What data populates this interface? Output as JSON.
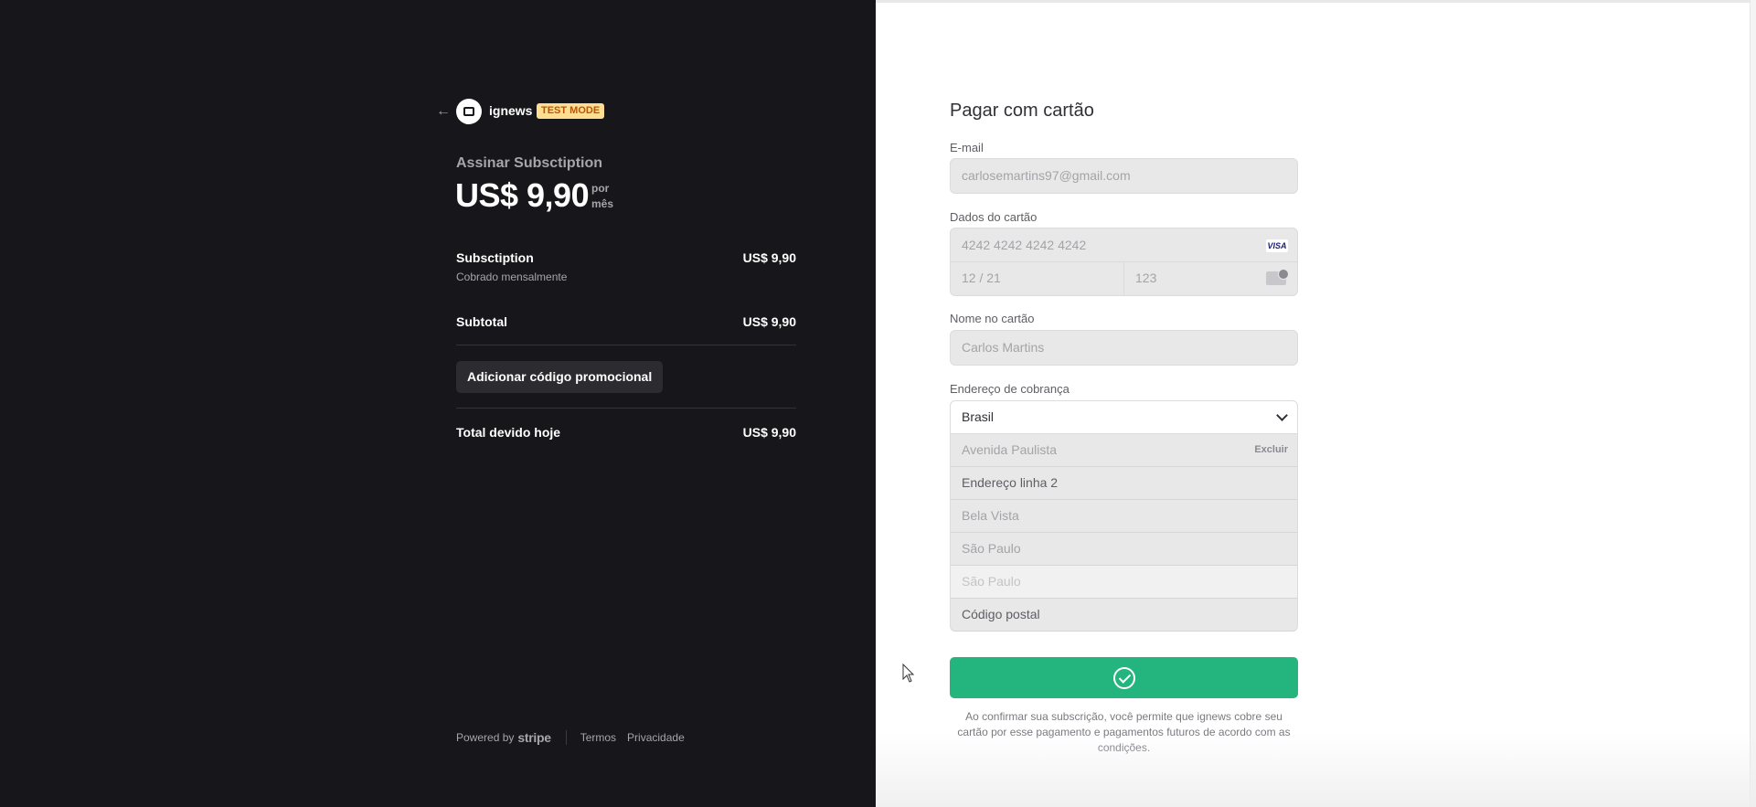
{
  "merchant": {
    "name": "ignews",
    "badge": "TEST MODE",
    "back_icon": "arrow-left-icon",
    "logo_icon": "store-logo-icon"
  },
  "summary": {
    "title": "Assinar Subsctiption",
    "price": "US$ 9,90",
    "per_line1": "por",
    "per_line2": "mês",
    "item_name": "Subsctiption",
    "item_price": "US$ 9,90",
    "item_note": "Cobrado mensalmente",
    "subtotal_label": "Subtotal",
    "subtotal_value": "US$ 9,90",
    "promo_label": "Adicionar código promocional",
    "total_label": "Total devido hoje",
    "total_value": "US$ 9,90"
  },
  "footer": {
    "powered_by": "Powered by",
    "stripe": "stripe",
    "terms": "Termos",
    "privacy": "Privacidade"
  },
  "form": {
    "title": "Pagar com cartão",
    "email_label": "E-mail",
    "email_value": "carlosemartins97@gmail.com",
    "card_label": "Dados do cartão",
    "card_number": "4242 4242 4242 4242",
    "card_brand": "VISA",
    "card_expiry": "12 / 21",
    "card_cvc": "123",
    "name_label": "Nome no cartão",
    "name_value": "Carlos Martins",
    "address_label": "Endereço de cobrança",
    "country": "Brasil",
    "address_line1": "Avenida Paulista",
    "remove_label": "Excluir",
    "address_line2": "Endereço linha 2",
    "neighborhood": "Bela Vista",
    "city": "São Paulo",
    "state": "São Paulo",
    "postal_code": "Código postal",
    "legal": "Ao confirmar sua subscrição, você permite que ignews cobre seu cartão por esse pagamento e pagamentos futuros de acordo com as condições."
  },
  "colors": {
    "left_bg": "#17171b",
    "pay_button": "#24b47e",
    "badge_bg": "#ffde92",
    "badge_text": "#b4570a"
  }
}
